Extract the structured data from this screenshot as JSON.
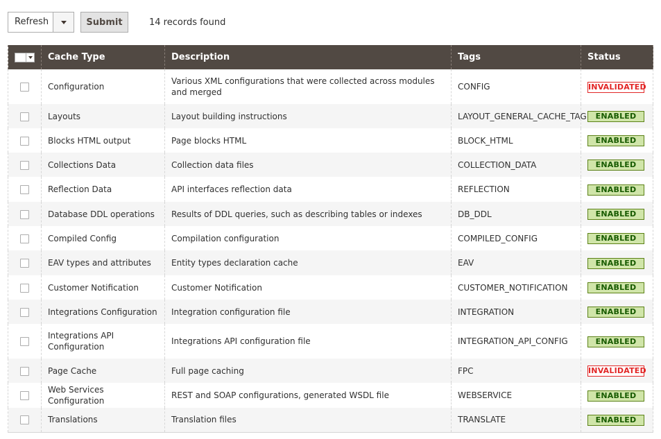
{
  "toolbar": {
    "refresh_label": "Refresh",
    "submit_label": "Submit",
    "records_found": "14 records found"
  },
  "grid": {
    "headers": {
      "cache_type": "Cache Type",
      "description": "Description",
      "tags": "Tags",
      "status": "Status"
    },
    "rows": [
      {
        "type": "Configuration",
        "description": "Various XML configurations that were collected across modules and merged",
        "tags": "CONFIG",
        "status": "INVALIDATED"
      },
      {
        "type": "Layouts",
        "description": "Layout building instructions",
        "tags": "LAYOUT_GENERAL_CACHE_TAG",
        "status": "ENABLED"
      },
      {
        "type": "Blocks HTML output",
        "description": "Page blocks HTML",
        "tags": "BLOCK_HTML",
        "status": "ENABLED"
      },
      {
        "type": "Collections Data",
        "description": "Collection data files",
        "tags": "COLLECTION_DATA",
        "status": "ENABLED"
      },
      {
        "type": "Reflection Data",
        "description": "API interfaces reflection data",
        "tags": "REFLECTION",
        "status": "ENABLED"
      },
      {
        "type": "Database DDL operations",
        "description": "Results of DDL queries, such as describing tables or indexes",
        "tags": "DB_DDL",
        "status": "ENABLED"
      },
      {
        "type": "Compiled Config",
        "description": "Compilation configuration",
        "tags": "COMPILED_CONFIG",
        "status": "ENABLED"
      },
      {
        "type": "EAV types and attributes",
        "description": "Entity types declaration cache",
        "tags": "EAV",
        "status": "ENABLED"
      },
      {
        "type": "Customer Notification",
        "description": "Customer Notification",
        "tags": "CUSTOMER_NOTIFICATION",
        "status": "ENABLED"
      },
      {
        "type": "Integrations Configuration",
        "description": "Integration configuration file",
        "tags": "INTEGRATION",
        "status": "ENABLED"
      },
      {
        "type": "Integrations API Configuration",
        "description": "Integrations API configuration file",
        "tags": "INTEGRATION_API_CONFIG",
        "status": "ENABLED"
      },
      {
        "type": "Page Cache",
        "description": "Full page caching",
        "tags": "FPC",
        "status": "INVALIDATED"
      },
      {
        "type": "Web Services Configuration",
        "description": "REST and SOAP configurations, generated WSDL file",
        "tags": "WEBSERVICE",
        "status": "ENABLED"
      },
      {
        "type": "Translations",
        "description": "Translation files",
        "tags": "TRANSLATE",
        "status": "ENABLED"
      }
    ]
  },
  "colors": {
    "header_bg": "#514943",
    "enabled_bg": "#d0e5a9",
    "enabled_text": "#185b00",
    "invalidated_text": "#e22626"
  }
}
